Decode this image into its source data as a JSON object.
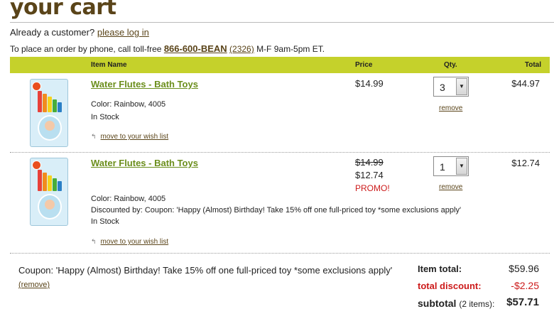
{
  "page": {
    "title": "your cart"
  },
  "login": {
    "prompt": "Already a customer?",
    "link": "please log in"
  },
  "phone": {
    "prefix": "To place an order by phone, call toll-free",
    "number": "866-600-BEAN",
    "ext": "(2326)",
    "hours": "M-F 9am-5pm ET."
  },
  "table": {
    "headers": [
      "Item Name",
      "Price",
      "Qty.",
      "Total"
    ]
  },
  "items": [
    {
      "name": "Water Flutes - Bath Toys",
      "color": "Color: Rainbow, 4005",
      "stock": "In Stock",
      "wish": "move to your wish list",
      "price": "$14.99",
      "qty": "3",
      "remove": "remove",
      "total": "$44.97"
    },
    {
      "name": "Water Flutes - Bath Toys",
      "color": "Color: Rainbow, 4005",
      "discount": "Discounted by: Coupon: 'Happy (Almost) Birthday! Take 15% off one full-priced toy *some exclusions apply'",
      "stock": "In Stock",
      "wish": "move to your wish list",
      "original_price": "$14.99",
      "price": "$12.74",
      "promo": "PROMO!",
      "qty": "1",
      "remove": "remove",
      "total": "$12.74"
    }
  ],
  "coupon": {
    "text": "Coupon: 'Happy (Almost) Birthday! Take 15% off one full-priced toy *some exclusions apply'",
    "remove": "(remove)"
  },
  "summary": {
    "item_total_label": "Item total:",
    "item_total": "$59.96",
    "discount_label": "total discount:",
    "discount": "-$2.25",
    "subtotal_label": "subtotal",
    "subtotal_count": "(2 items):",
    "subtotal": "$57.71"
  },
  "colors": {
    "header_bar": "#c5d12b",
    "title": "#5a4419",
    "product_link": "#6b8e1c",
    "promo": "#cc1a1a"
  },
  "icons": {
    "wish_arrow": "arrow-icon",
    "dropdown": "chevron-down-icon"
  }
}
